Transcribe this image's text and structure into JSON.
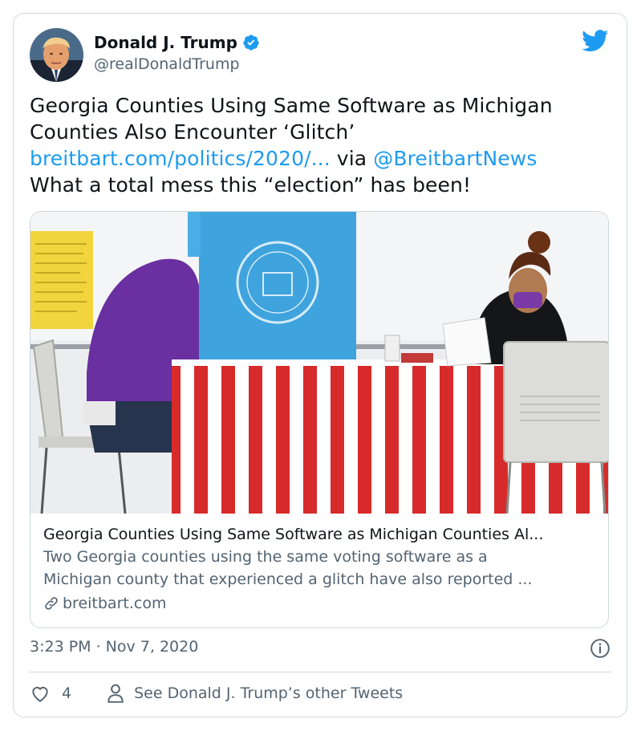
{
  "author": {
    "name": "Donald J. Trump",
    "handle": "@realDonaldTrump",
    "verified": true,
    "avatar_icon": "profile-photo"
  },
  "tweet": {
    "line1": "Georgia Counties Using Same Software as Michigan",
    "line2": "Counties Also Encounter ‘Glitch’",
    "link_text": "breitbart.com/politics/2020/...",
    "via_text": " via ",
    "mention": "@BreitbartNews",
    "line4": "What a total mess this “election” has been!"
  },
  "preview": {
    "title": "Georgia Counties Using Same Software as Michigan Counties Al...",
    "desc1": "Two Georgia counties using the same voting software as a",
    "desc2": "Michigan county that experienced a glitch have also reported ...",
    "domain": "breitbart.com",
    "image_icon": "voting-booth-photo"
  },
  "footer": {
    "timestamp": "3:23 PM · Nov 7, 2020",
    "likes": "4",
    "other_tweets": "See Donald J. Trump’s other Tweets"
  },
  "colors": {
    "link": "#1d9bf0",
    "muted": "#536471",
    "border": "#cfd9de",
    "text": "#0f1419"
  }
}
